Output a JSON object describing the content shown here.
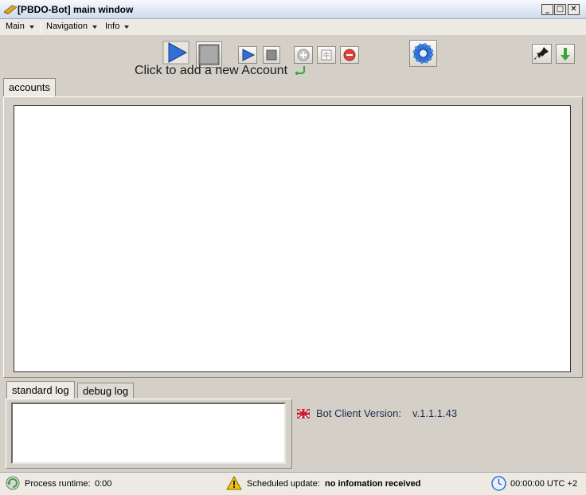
{
  "window": {
    "title": "[PBDO-Bot] main window",
    "minimize": "_",
    "maximize": "□",
    "close": "✕"
  },
  "menu": {
    "items": [
      "Main",
      "Navigation",
      "Info"
    ]
  },
  "toolbar": {
    "hint": "Click to add a new Account",
    "icons": [
      "play-large-icon",
      "stop-large-icon",
      "play-small-icon",
      "stop-small-icon",
      "add-account-icon",
      "edit-account-icon",
      "remove-account-icon",
      "settings-gear-icon",
      "pin-icon",
      "download-arrow-icon"
    ]
  },
  "tabs": {
    "accounts": "accounts",
    "standard_log": "standard log",
    "debug_log": "debug log"
  },
  "version": {
    "label": "Bot Client Version:",
    "value": "v.1.1.1.43"
  },
  "status": {
    "runtime_label": "Process runtime:",
    "runtime_value": "0:00",
    "update_label": "Scheduled update:",
    "update_value": "no infomation received",
    "clock": "00:00:00 UTC +2"
  },
  "colors": {
    "accent_blue": "#2f6fd6",
    "window_bg": "#d4d0c8",
    "warning_yellow": "#f2c200"
  }
}
